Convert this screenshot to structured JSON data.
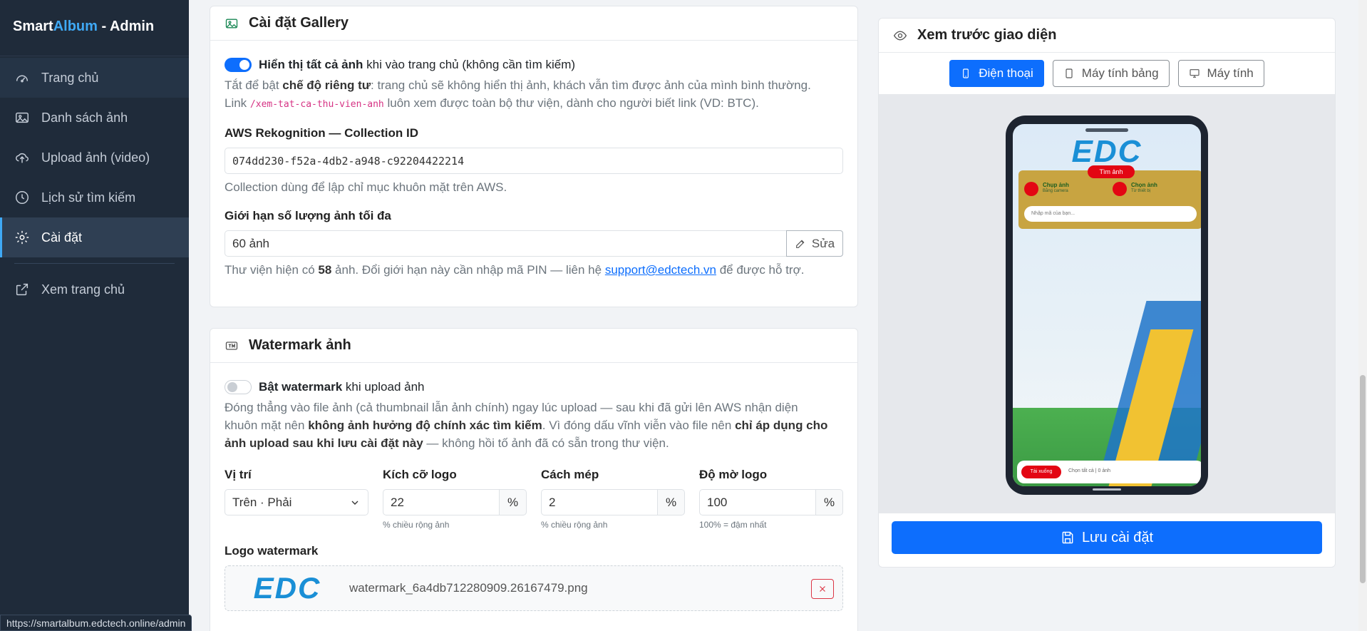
{
  "sidebar": {
    "brand_pre": "Smart",
    "brand_accent": "Album",
    "brand_post": " - Admin",
    "items": [
      {
        "label": "Trang chủ",
        "icon": "dashboard-icon"
      },
      {
        "label": "Danh sách ảnh",
        "icon": "image-icon"
      },
      {
        "label": "Upload ảnh (video)",
        "icon": "cloud-upload-icon"
      },
      {
        "label": "Lịch sử tìm kiếm",
        "icon": "clock-icon"
      },
      {
        "label": "Cài đặt",
        "icon": "gear-icon",
        "active": true
      },
      {
        "label": "Xem trang chủ",
        "icon": "external-link-icon"
      }
    ]
  },
  "gallery": {
    "title": "Cài đặt Gallery",
    "toggle_bold": "Hiển thị tất cả ảnh",
    "toggle_rest": " khi vào trang chủ (không cần tìm kiếm)",
    "toggle_on": true,
    "desc_1": "Tắt để bật ",
    "desc_bold": "chế độ riêng tư",
    "desc_2": ": trang chủ sẽ không hiển thị ảnh, khách vẫn tìm được ảnh của mình bình thường.",
    "desc_3": "Link ",
    "desc_code": "/xem-tat-ca-thu-vien-anh",
    "desc_4": " luôn xem được toàn bộ thư viện, dành cho người biết link (VD: BTC).",
    "aws_label": "AWS Rekognition — Collection ID",
    "aws_value": "074dd230-f52a-4db2-a948-c92204422214",
    "aws_help": "Collection dùng để lập chỉ mục khuôn mặt trên AWS.",
    "limit_label": "Giới hạn số lượng ảnh tối đa",
    "limit_value": "60 ảnh",
    "edit_button": "Sửa",
    "limit_help_1": "Thư viện hiện có ",
    "limit_help_count": "58",
    "limit_help_2": " ảnh. Đổi giới hạn này cần nhập mã PIN — liên hệ ",
    "limit_help_email": "support@edctech.vn",
    "limit_help_3": " để được hỗ trợ."
  },
  "watermark": {
    "title": "Watermark ảnh",
    "toggle_bold": "Bật watermark",
    "toggle_rest": " khi upload ảnh",
    "toggle_on": false,
    "desc_1": "Đóng thẳng vào file ảnh (cả thumbnail lẫn ảnh chính) ngay lúc upload — sau khi đã gửi lên AWS nhận diện",
    "desc_2": "khuôn mặt nên ",
    "desc_bold_1": "không ảnh hưởng độ chính xác tìm kiếm",
    "desc_3": ". Vì đóng dấu vĩnh viễn vào file nên ",
    "desc_bold_2": "chỉ áp dụng cho",
    "desc_bold_3": "ảnh upload sau khi lưu cài đặt này",
    "desc_4": " — không hồi tố ảnh đã có sẵn trong thư viện.",
    "position_label": "Vị trí",
    "position_value": "Trên · Phải",
    "size_label": "Kích cỡ logo",
    "size_value": "22",
    "size_help": "% chiều rộng ảnh",
    "margin_label": "Cách mép",
    "margin_value": "2",
    "margin_help": "% chiều rộng ảnh",
    "opacity_label": "Độ mờ logo",
    "opacity_value": "100",
    "opacity_help": "100% = đậm nhất",
    "unit": "%",
    "logo_label": "Logo watermark",
    "logo_text": "EDC",
    "logo_filename": "watermark_6a4db712280909.26167479.png"
  },
  "preview": {
    "title": "Xem trước giao diện",
    "tabs": [
      {
        "label": "Điện thoại",
        "icon": "phone-icon",
        "active": true
      },
      {
        "label": "Máy tính bảng",
        "icon": "tablet-icon",
        "active": false
      },
      {
        "label": "Máy tính",
        "icon": "monitor-icon",
        "active": false
      }
    ],
    "phone": {
      "logo": "EDC",
      "pill": "Tìm ảnh",
      "take_title": "Chụp ảnh",
      "take_sub": "Bằng camera",
      "pick_title": "Chọn ảnh",
      "pick_sub": "Từ thiết bị",
      "input_placeholder": "Nhập mã của bạn...",
      "bottom_pill": "Tải xuống",
      "bottom_text": "Chọn tất cả | 0 ảnh"
    },
    "save_label": "Lưu cài đặt"
  },
  "status_url": "https://smartalbum.edctech.online/admin",
  "colors": {
    "primary": "#0d6efd",
    "sidebar": "#1f2b3a",
    "accent": "#3fa9f5",
    "danger": "#dc3545"
  }
}
